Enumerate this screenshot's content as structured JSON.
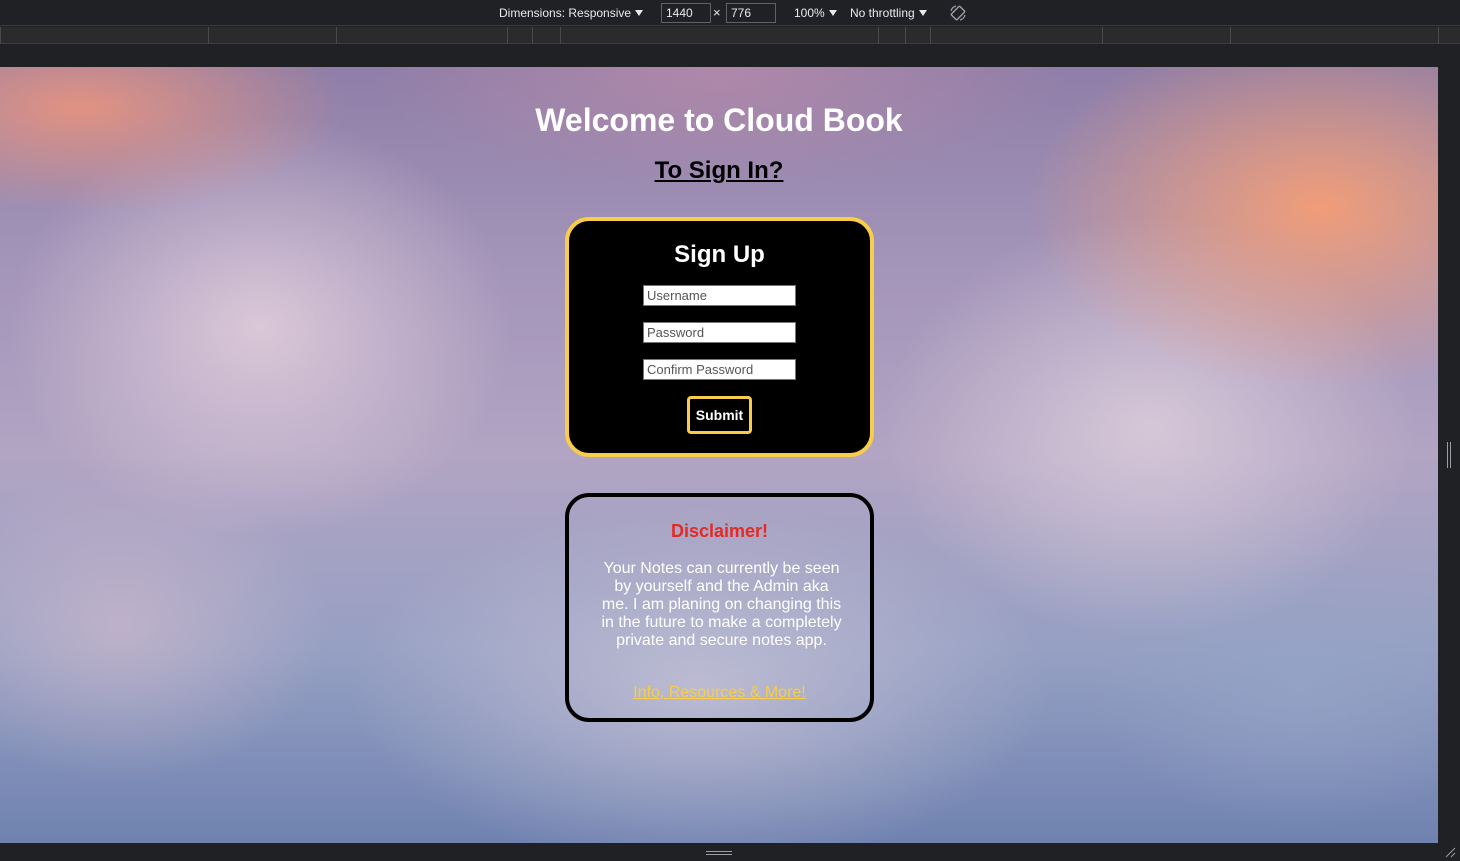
{
  "devtools": {
    "dimensions_label": "Dimensions: Responsive",
    "width_value": "1440",
    "times": "×",
    "height_value": "776",
    "zoom": "100%",
    "throttling": "No throttling",
    "rotate_icon": "rotate-icon"
  },
  "page": {
    "title": "Welcome to Cloud Book",
    "signin_link": "To Sign In?",
    "signup": {
      "heading": "Sign Up",
      "username_placeholder": "Username",
      "password_placeholder": "Password",
      "confirm_placeholder": "Confirm Password",
      "submit": "Submit"
    },
    "disclaimer": {
      "heading": "Disclaimer!",
      "body": "Your Notes can currently be seen by yourself and the Admin aka me. I am planing on changing this in the future to make a completely private and secure notes app.",
      "link": "Info, Resources & More!"
    }
  },
  "colors": {
    "accent": "#f7cd4a",
    "warning": "#e52a24",
    "card": "#000000"
  }
}
